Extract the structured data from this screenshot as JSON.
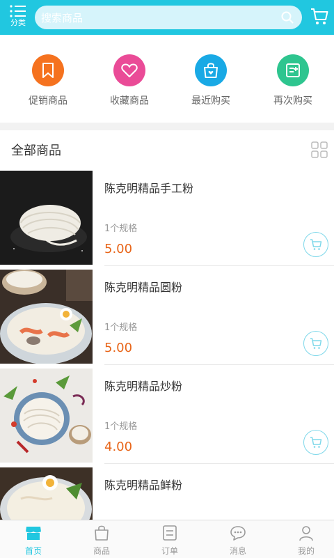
{
  "header": {
    "category_label": "分类",
    "search_placeholder": "搜索商品"
  },
  "quick_actions": [
    {
      "label": "促销商品",
      "icon": "bookmark-icon",
      "color": "#f5721f"
    },
    {
      "label": "收藏商品",
      "icon": "heart-icon",
      "color": "#ea4b97"
    },
    {
      "label": "最近购买",
      "icon": "shopping-bag-icon",
      "color": "#19a9e5"
    },
    {
      "label": "再次购买",
      "icon": "receipt-icon",
      "color": "#2ec58f"
    }
  ],
  "section": {
    "title": "全部商品"
  },
  "products": [
    {
      "name": "陈克明精品手工粉",
      "spec": "1个规格",
      "price": "5.00"
    },
    {
      "name": "陈克明精品圆粉",
      "spec": "1个规格",
      "price": "5.00"
    },
    {
      "name": "陈克明精品炒粉",
      "spec": "1个规格",
      "price": "4.00"
    },
    {
      "name": "陈克明精品鲜粉",
      "spec": "",
      "price": ""
    }
  ],
  "tabbar": [
    {
      "label": "首页",
      "icon": "home-icon",
      "active": true
    },
    {
      "label": "商品",
      "icon": "product-bag-icon",
      "active": false
    },
    {
      "label": "订单",
      "icon": "order-icon",
      "active": false
    },
    {
      "label": "消息",
      "icon": "message-icon",
      "active": false
    },
    {
      "label": "我的",
      "icon": "user-icon",
      "active": false
    }
  ],
  "colors": {
    "accent": "#21c7e0",
    "price": "#e8661a"
  }
}
